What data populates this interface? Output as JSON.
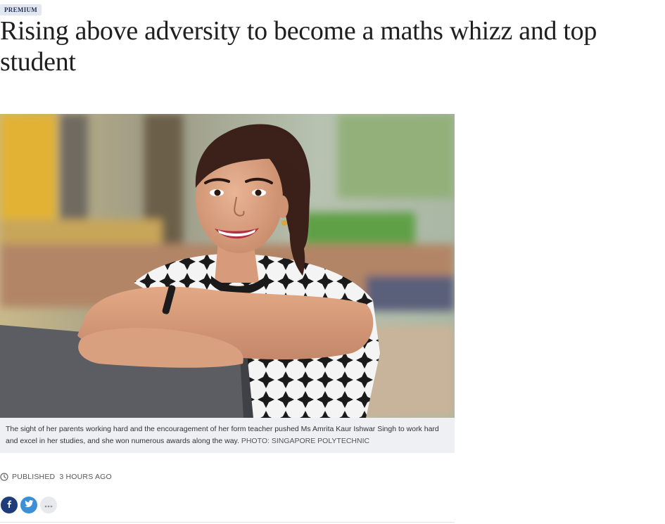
{
  "article": {
    "badge": "PREMIUM",
    "headline": "Rising above adversity to become a maths whizz and top student",
    "caption": {
      "text": "The sight of her parents working hard and the encouragement of her form teacher pushed Ms Amrita Kaur Ishwar Singh to work hard and excel in her studies, and she won numerous awards along the way.",
      "credit": "PHOTO: SINGAPORE POLYTECHNIC"
    },
    "published": {
      "label": "PUBLISHED",
      "time": "3 HOURS AGO"
    }
  },
  "share": {
    "facebook_icon": "facebook-icon",
    "twitter_icon": "twitter-icon",
    "more_icon": "more-dots-icon",
    "facebook_color": "#1f3b7a",
    "twitter_color": "#3b8fd6"
  },
  "colors": {
    "badge_bg": "#e3e8f0",
    "badge_text": "#1e2f5a",
    "caption_bg": "#eef0f3"
  }
}
